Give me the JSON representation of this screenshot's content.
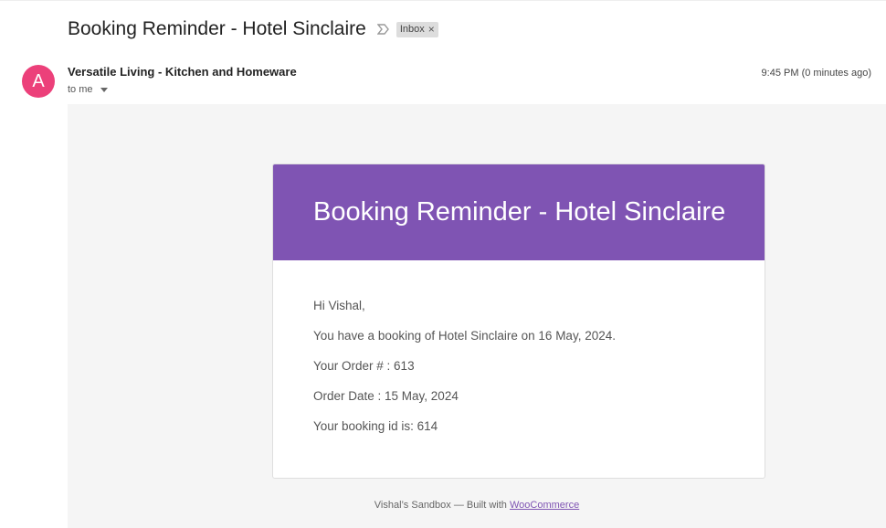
{
  "email": {
    "subject": "Booking Reminder - Hotel Sinclaire",
    "label": "Inbox",
    "label_close": "×",
    "importance_icon": "importance-marker-icon",
    "sender_name": "Versatile Living - Kitchen and Homeware",
    "avatar_letter": "A",
    "avatar_color": "#ec407a",
    "recipient": "to me",
    "timestamp": "9:45 PM (0 minutes ago)"
  },
  "message": {
    "header_title": "Booking Reminder - Hotel Sinclaire",
    "header_color": "#7f54b3",
    "greeting": "Hi Vishal,",
    "line_booking": "You have a booking of Hotel Sinclaire on 16 May, 2024.",
    "line_order_number": "Your Order # : 613",
    "line_order_date": "Order Date : 15 May, 2024",
    "line_booking_id": "Your booking id is: 614",
    "footer_prefix": "Vishal’s Sandbox — Built with ",
    "footer_link": "WooCommerce"
  }
}
